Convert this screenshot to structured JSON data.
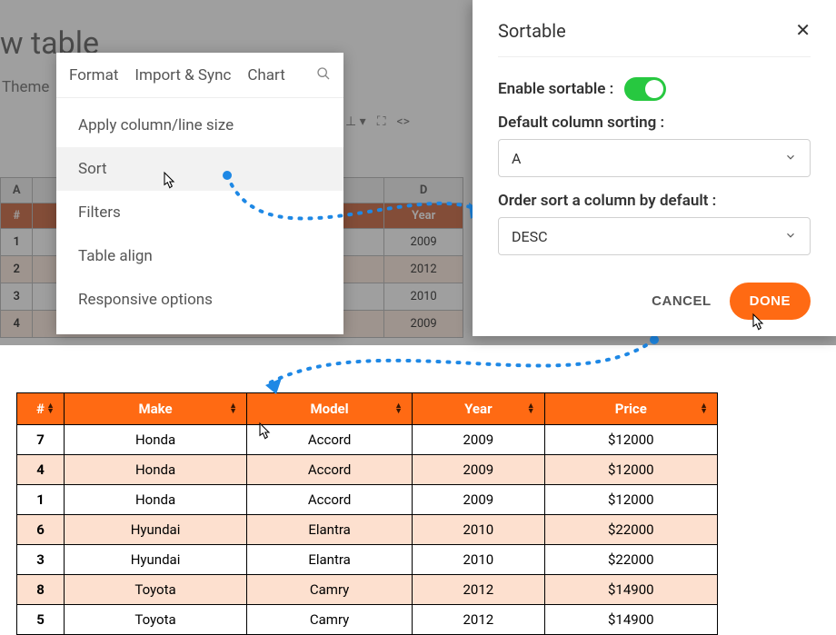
{
  "page": {
    "title": "ew table"
  },
  "topTabs": [
    "Theme"
  ],
  "menu": {
    "tabs": [
      "Format",
      "Import & Sync",
      "Chart"
    ],
    "items": [
      {
        "label": "Apply column/line size"
      },
      {
        "label": "Sort",
        "hover": true
      },
      {
        "label": "Filters"
      },
      {
        "label": "Table align"
      },
      {
        "label": "Responsive options"
      }
    ]
  },
  "bgGrid": {
    "cols": [
      "A",
      "D"
    ],
    "header": {
      "a": "#",
      "d": "Year"
    },
    "rows": [
      {
        "n": "1",
        "d": "2009"
      },
      {
        "n": "2",
        "d": "2012"
      },
      {
        "n": "3",
        "d": "2010"
      },
      {
        "n": "4",
        "d": "2009"
      }
    ]
  },
  "modal": {
    "title": "Sortable",
    "enableLabel": "Enable sortable :",
    "defaultLabel": "Default column sorting :",
    "defaultValue": "A",
    "orderLabel": "Order sort a column by default :",
    "orderValue": "DESC",
    "cancel": "CANCEL",
    "done": "DONE"
  },
  "chart_data": {
    "type": "table",
    "columns": [
      "#",
      "Make",
      "Model",
      "Year",
      "Price"
    ],
    "rows": [
      [
        "7",
        "Honda",
        "Accord",
        "2009",
        "$12000"
      ],
      [
        "4",
        "Honda",
        "Accord",
        "2009",
        "$12000"
      ],
      [
        "1",
        "Honda",
        "Accord",
        "2009",
        "$12000"
      ],
      [
        "6",
        "Hyundai",
        "Elantra",
        "2010",
        "$22000"
      ],
      [
        "3",
        "Hyundai",
        "Elantra",
        "2010",
        "$22000"
      ],
      [
        "8",
        "Toyota",
        "Camry",
        "2012",
        "$14900"
      ],
      [
        "5",
        "Toyota",
        "Camry",
        "2012",
        "$14900"
      ]
    ]
  }
}
